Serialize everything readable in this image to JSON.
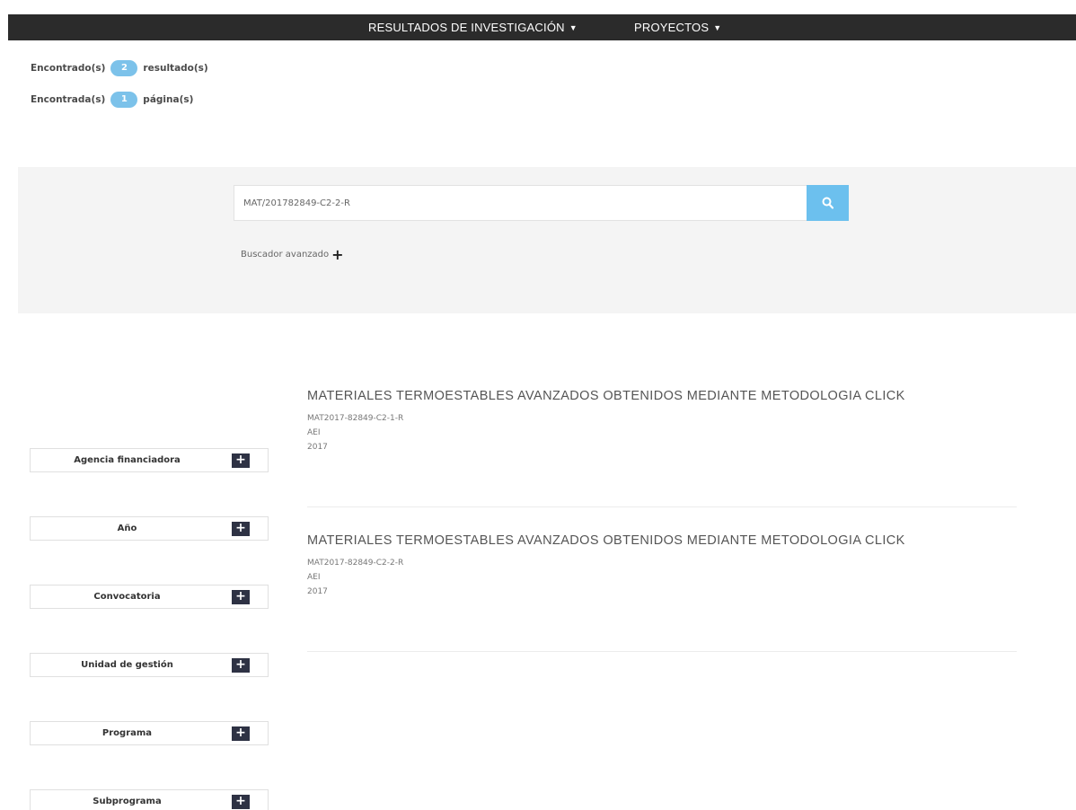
{
  "nav": {
    "items": [
      {
        "label": "RESULTADOS DE INVESTIGACIÓN"
      },
      {
        "label": "PROYECTOS"
      }
    ]
  },
  "counts": {
    "results_prefix": "Encontrado(s)",
    "results_value": "2",
    "results_suffix": "resultado(s)",
    "pages_prefix": "Encontrada(s)",
    "pages_value": "1",
    "pages_suffix": "página(s)"
  },
  "search": {
    "value": "MAT/201782849-C2-2-R",
    "button_icon": "search-icon",
    "advanced_label": "Buscador avanzado"
  },
  "filters": [
    {
      "label": "Agencia financiadora"
    },
    {
      "label": "Año"
    },
    {
      "label": "Convocatoria"
    },
    {
      "label": "Unidad de gestión"
    },
    {
      "label": "Programa"
    },
    {
      "label": "Subprograma"
    }
  ],
  "results": [
    {
      "title": "MATERIALES TERMOESTABLES AVANZADOS OBTENIDOS MEDIANTE METODOLOGIA CLICK",
      "code": "MAT2017-82849-C2-1-R",
      "agency": "AEI",
      "year": "2017"
    },
    {
      "title": "MATERIALES TERMOESTABLES AVANZADOS OBTENIDOS MEDIANTE METODOLOGIA CLICK",
      "code": "MAT2017-82849-C2-2-R",
      "agency": "AEI",
      "year": "2017"
    }
  ],
  "colors": {
    "navbar": "#2b2b2b",
    "badge": "#7cc2ea",
    "search_button": "#6cc0ee",
    "filter_plus": "#2e3244"
  }
}
